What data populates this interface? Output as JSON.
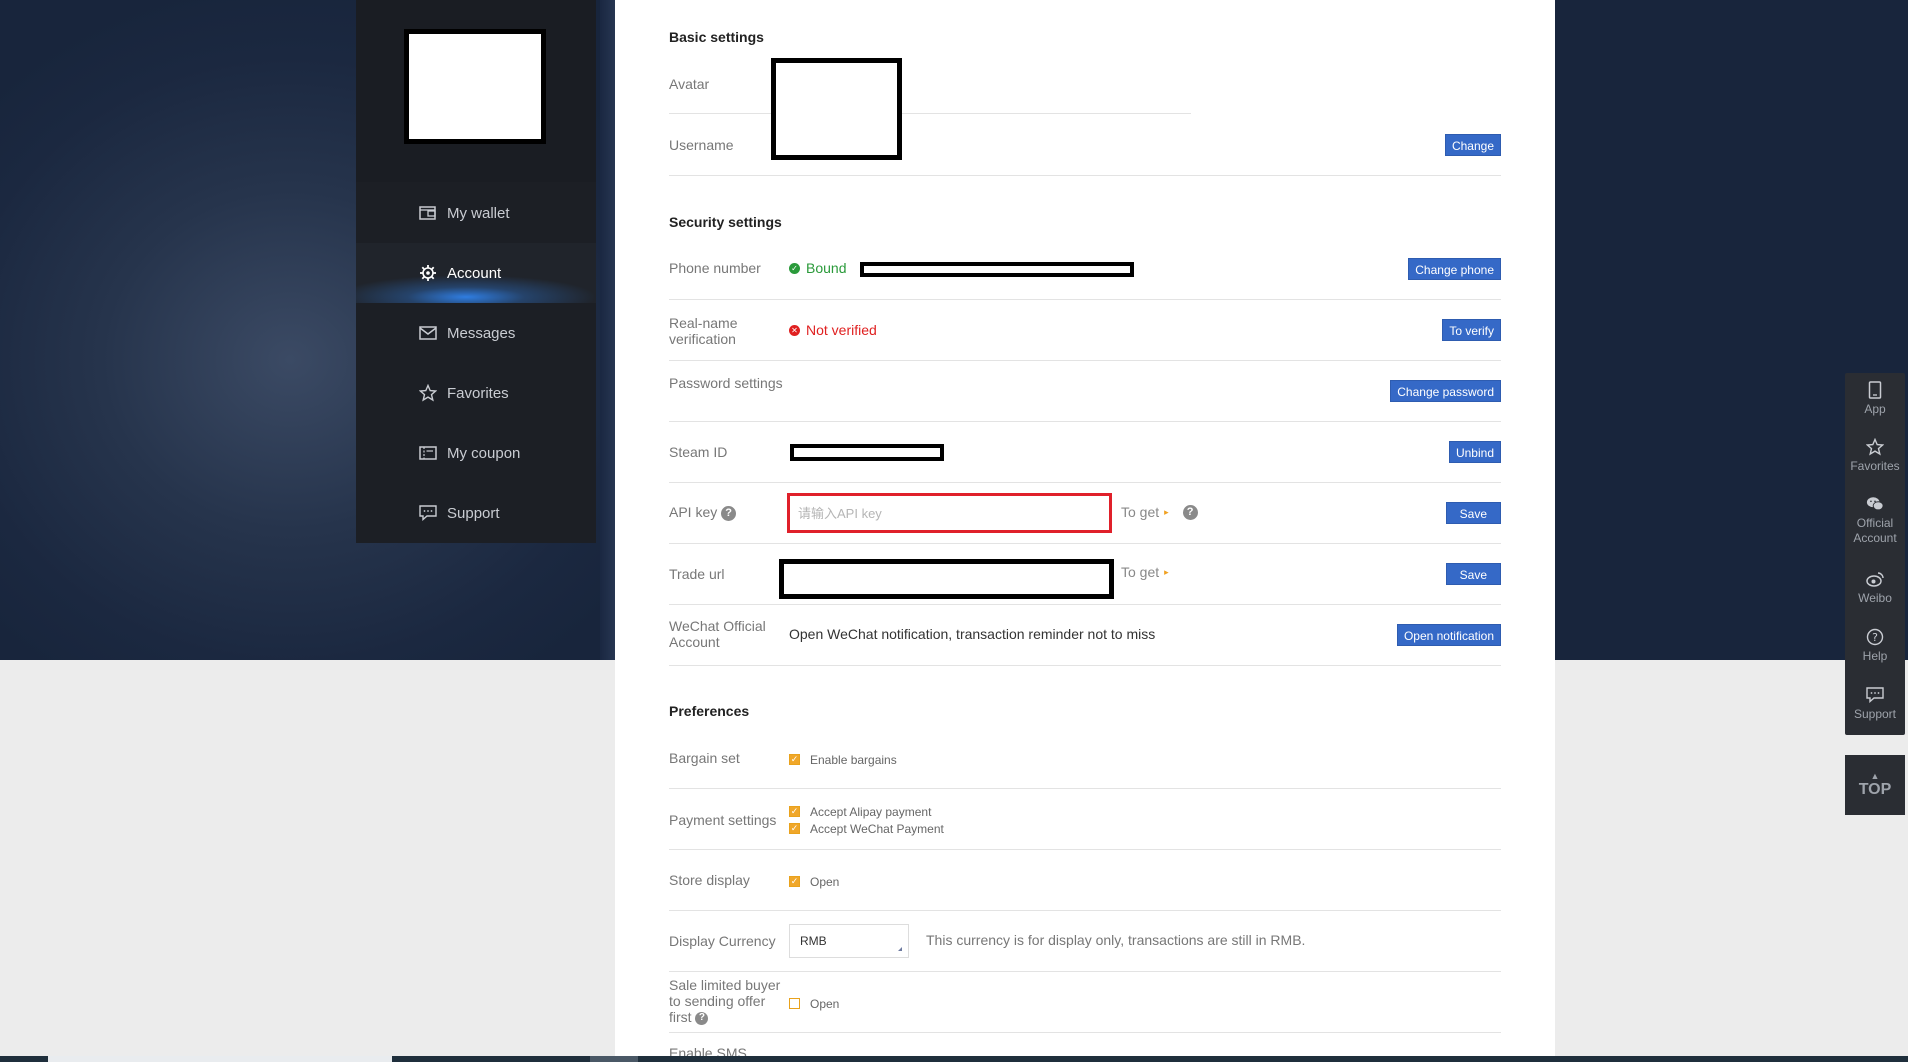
{
  "sidebar": {
    "items": [
      {
        "label": "My wallet",
        "icon": "wallet-icon"
      },
      {
        "label": "Account",
        "icon": "gear-icon",
        "active": true
      },
      {
        "label": "Messages",
        "icon": "envelope-icon"
      },
      {
        "label": "Favorites",
        "icon": "star-icon"
      },
      {
        "label": "My coupon",
        "icon": "coupon-icon"
      },
      {
        "label": "Support",
        "icon": "chat-icon"
      }
    ]
  },
  "basic": {
    "title": "Basic settings",
    "avatar_label": "Avatar",
    "username_label": "Username",
    "change_btn": "Change"
  },
  "security": {
    "title": "Security settings",
    "phone_label": "Phone number",
    "phone_status": "Bound",
    "change_phone_btn": "Change phone",
    "realname_label": "Real-name verification",
    "realname_status": "Not verified",
    "verify_btn": "To verify",
    "password_label": "Password settings",
    "change_password_btn": "Change password",
    "steam_label": "Steam ID",
    "unbind_btn": "Unbind",
    "api_label": "API key",
    "api_placeholder": "请输入API key",
    "api_toget": "To get",
    "api_save_btn": "Save",
    "trade_label": "Trade url",
    "trade_toget": "To get",
    "trade_save_btn": "Save",
    "wechat_label": "WeChat Official Account",
    "wechat_text": "Open WeChat notification, transaction reminder not to miss",
    "wechat_btn": "Open notification"
  },
  "preferences": {
    "title": "Preferences",
    "bargain_label": "Bargain set",
    "bargain_opt": "Enable bargains",
    "payment_label": "Payment settings",
    "payment_opt1": "Accept Alipay payment",
    "payment_opt2": "Accept WeChat Payment",
    "store_label": "Store display",
    "store_opt": "Open",
    "currency_label": "Display Currency",
    "currency_value": "RMB",
    "currency_note": "This currency is for display only, transactions are still in RMB.",
    "sale_label": "Sale limited buyer to sending offer first",
    "sale_opt": "Open",
    "sms_label": "Enable SMS"
  },
  "float_bar": {
    "items": [
      {
        "label": "App",
        "icon": "phone-icon"
      },
      {
        "label": "Favorites",
        "icon": "star-icon"
      },
      {
        "label": "Official Account",
        "icon": "wechat-icon"
      },
      {
        "label": "Weibo",
        "icon": "weibo-icon"
      },
      {
        "label": "Help",
        "icon": "help-icon"
      },
      {
        "label": "Support",
        "icon": "chat-icon"
      }
    ],
    "top_label": "TOP"
  },
  "colors": {
    "accent": "#3569c7",
    "danger": "#e02020",
    "success": "#2a9a3a",
    "checkbox": "#f0a72a"
  }
}
